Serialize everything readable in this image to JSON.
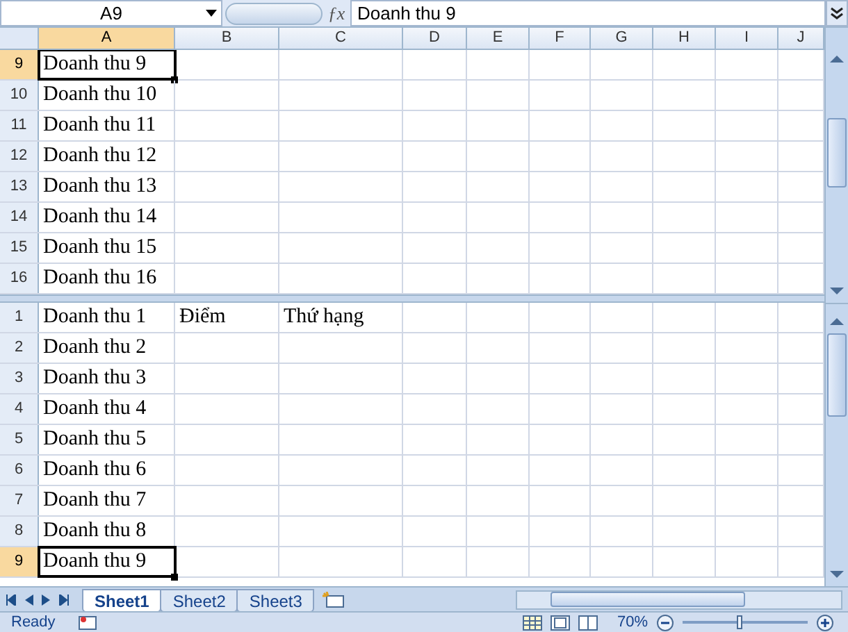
{
  "formula_bar": {
    "name_box": "A9",
    "function_label": "ƒx",
    "formula": "Doanh thu 9"
  },
  "columns": [
    {
      "label": "A",
      "selected": true
    },
    {
      "label": "B",
      "selected": false
    },
    {
      "label": "C",
      "selected": false
    },
    {
      "label": "D",
      "selected": false
    },
    {
      "label": "E",
      "selected": false
    },
    {
      "label": "F",
      "selected": false
    },
    {
      "label": "G",
      "selected": false
    },
    {
      "label": "H",
      "selected": false
    },
    {
      "label": "I",
      "selected": false
    },
    {
      "label": "J",
      "selected": false
    }
  ],
  "panes": [
    {
      "rows": [
        {
          "number": "9",
          "selected": true,
          "cells": [
            "Doanh thu 9"
          ]
        },
        {
          "number": "10",
          "selected": false,
          "cells": [
            "Doanh thu 10"
          ]
        },
        {
          "number": "11",
          "selected": false,
          "cells": [
            "Doanh thu 11"
          ]
        },
        {
          "number": "12",
          "selected": false,
          "cells": [
            "Doanh thu 12"
          ]
        },
        {
          "number": "13",
          "selected": false,
          "cells": [
            "Doanh thu 13"
          ]
        },
        {
          "number": "14",
          "selected": false,
          "cells": [
            "Doanh thu 14"
          ]
        },
        {
          "number": "15",
          "selected": false,
          "cells": [
            "Doanh thu 15"
          ]
        },
        {
          "number": "16",
          "selected": false,
          "cells": [
            "Doanh thu 16"
          ]
        }
      ]
    },
    {
      "rows": [
        {
          "number": "1",
          "selected": false,
          "cells": [
            "Doanh thu 1",
            "Điểm",
            "Thứ hạng"
          ]
        },
        {
          "number": "2",
          "selected": false,
          "cells": [
            "Doanh thu 2"
          ]
        },
        {
          "number": "3",
          "selected": false,
          "cells": [
            "Doanh thu 3"
          ]
        },
        {
          "number": "4",
          "selected": false,
          "cells": [
            "Doanh thu 4"
          ]
        },
        {
          "number": "5",
          "selected": false,
          "cells": [
            "Doanh thu 5"
          ]
        },
        {
          "number": "6",
          "selected": false,
          "cells": [
            "Doanh thu 6"
          ]
        },
        {
          "number": "7",
          "selected": false,
          "cells": [
            "Doanh thu 7"
          ]
        },
        {
          "number": "8",
          "selected": false,
          "cells": [
            "Doanh thu 8"
          ]
        },
        {
          "number": "9",
          "selected": true,
          "cells": [
            "Doanh thu 9"
          ]
        }
      ]
    }
  ],
  "sheet_tabs": [
    {
      "label": "Sheet1",
      "selected": true
    },
    {
      "label": "Sheet2",
      "selected": false
    },
    {
      "label": "Sheet3",
      "selected": false
    }
  ],
  "status_bar": {
    "status": "Ready",
    "zoom": "70%",
    "zoom_slider": {
      "level": 0.45
    }
  }
}
